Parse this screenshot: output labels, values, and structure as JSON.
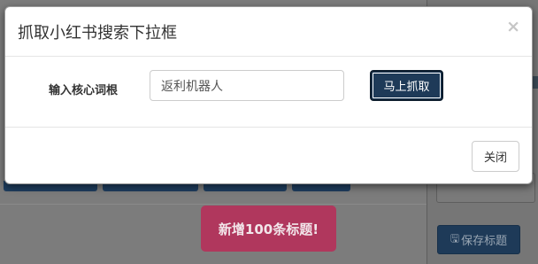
{
  "background": {
    "primary_button_label": "新增100条标题!",
    "save_button_label": "保存标题",
    "save_icon": "save-icon"
  },
  "modal": {
    "title": "抓取小红书搜索下拉框",
    "close_symbol": "×",
    "field_label": "输入核心词根",
    "keyword_value": "返利机器人",
    "grab_button_label": "马上抓取",
    "close_button_label": "关闭"
  },
  "colors": {
    "primary_dark": "#1e3a58",
    "pink": "#b0375d",
    "overlay": "#7c7c7c"
  }
}
